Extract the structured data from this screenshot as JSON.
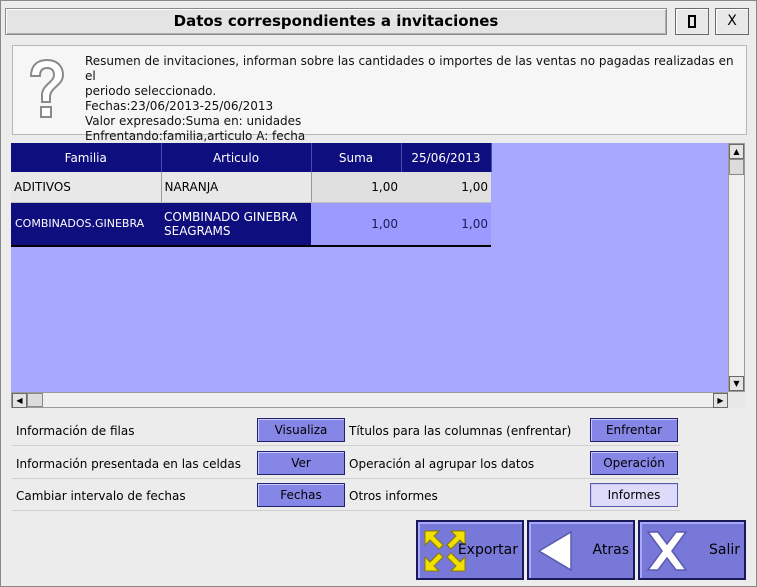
{
  "window": {
    "title": "Datos correspondientes a invitaciones",
    "close_label": "X"
  },
  "info": {
    "line1": "Resumen de invitaciones, informan sobre las cantidades o importes de las ventas no pagadas realizadas en el",
    "line2": "periodo seleccionado.",
    "line3": "Fechas:23/06/2013-25/06/2013",
    "line4": "Valor expresado:Suma en: unidades",
    "line5": "Enfrentando:familia,articulo A: fecha"
  },
  "table": {
    "headers": [
      "Familia",
      "Articulo",
      "Suma",
      "25/06/2013"
    ],
    "rows": [
      [
        "ADITIVOS",
        "NARANJA",
        "1,00",
        "1,00"
      ],
      [
        "COMBINADOS.GINEBRA",
        "COMBINADO GINEBRA SEAGRAMS",
        "1,00",
        "1,00"
      ]
    ]
  },
  "options": [
    {
      "label": "Información de filas",
      "button": "Visualiza"
    },
    {
      "label": "Información presentada en las celdas",
      "button": "Ver"
    },
    {
      "label": "Cambiar intervalo de fechas",
      "button": "Fechas"
    }
  ],
  "options_right": [
    {
      "label": "Títulos para las columnas (enfrentar)",
      "button": "Enfrentar"
    },
    {
      "label": "Operación al agrupar los datos",
      "button": "Operación"
    },
    {
      "label": "Otros informes",
      "button": "Informes"
    }
  ],
  "actions": {
    "export": "Exportar",
    "back": "Atras",
    "exit": "Salir"
  },
  "colors": {
    "grid_bg": "#a8a8ff",
    "header_bg": "#0e0e7e",
    "button_bg": "#8686e6"
  }
}
